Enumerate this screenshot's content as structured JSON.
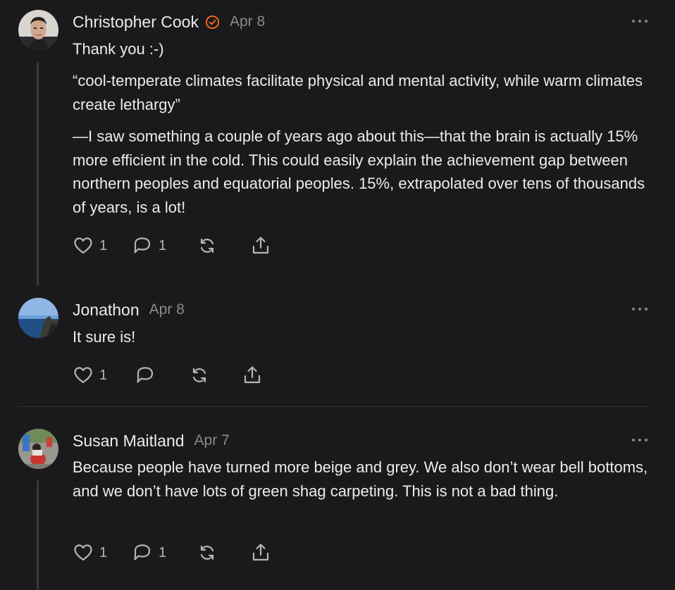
{
  "comments": [
    {
      "author": "Christopher Cook",
      "date": "Apr 8",
      "verified": true,
      "paragraphs": [
        "Thank you :-)",
        "“cool-temperate climates facilitate physical and mental activity, while warm climates create lethargy”",
        "—I saw something a couple of years ago about this—that the brain is actually 15% more efficient in the cold. This could easily explain the achievement gap between northern peoples and equatorial peoples. 15%, extrapolated over tens of thousands of years, is a lot!"
      ],
      "likes": "1",
      "replies": "1"
    },
    {
      "author": "Jonathon",
      "date": "Apr 8",
      "paragraphs": [
        "It sure is!"
      ],
      "likes": "1",
      "replies": ""
    },
    {
      "author": "Susan Maitland",
      "date": "Apr 7",
      "paragraphs": [
        "Because people have turned more beige and grey. We also don’t wear bell bottoms, and we don’t have lots of green shag carpeting. This is not a bad thing."
      ],
      "likes": "1",
      "replies": "1"
    }
  ],
  "icons": {
    "like": "heart-icon",
    "reply": "comment-bubble-icon",
    "restack": "restack-icon",
    "share": "share-icon",
    "menu": "more-dots-icon",
    "verified": "verified-check-icon"
  },
  "colors": {
    "background": "#1a1a1c",
    "text": "#ececec",
    "muted": "#8a8a8e",
    "accent": "#ff6719"
  }
}
